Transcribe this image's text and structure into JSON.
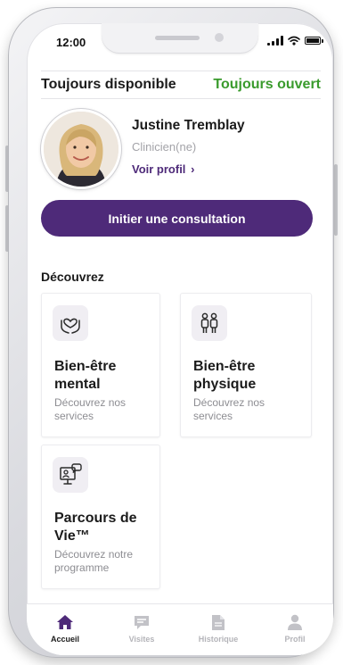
{
  "status_bar": {
    "time": "12:00"
  },
  "availability": {
    "label": "Toujours disponible",
    "status": "Toujours ouvert"
  },
  "clinician": {
    "name": "Justine Tremblay",
    "role": "Clinicien(ne)",
    "profile_link": "Voir profil",
    "profile_chevron": "›"
  },
  "cta": {
    "label": "Initier une consultation"
  },
  "discover": {
    "title": "Découvrez",
    "cards": [
      {
        "title": "Bien-être mental",
        "description": "Découvrez nos services",
        "icon": "heart-hands-icon"
      },
      {
        "title": "Bien-être physique",
        "description": "Découvrez nos services",
        "icon": "people-icon"
      },
      {
        "title": "Parcours de Vie™",
        "description": "Découvrez notre programme",
        "icon": "presentation-icon"
      }
    ]
  },
  "nav": {
    "items": [
      {
        "label": "Accueil",
        "icon": "home-icon",
        "active": true
      },
      {
        "label": "Visites",
        "icon": "chat-icon",
        "active": false
      },
      {
        "label": "Historique",
        "icon": "document-icon",
        "active": false
      },
      {
        "label": "Profil",
        "icon": "user-icon",
        "active": false
      }
    ]
  },
  "colors": {
    "brand": "#4e2a79",
    "status_open": "#3a9b2d",
    "text": "#1b1b1b",
    "muted": "#a3a3a8",
    "nav_inactive": "#b4b4b9"
  }
}
